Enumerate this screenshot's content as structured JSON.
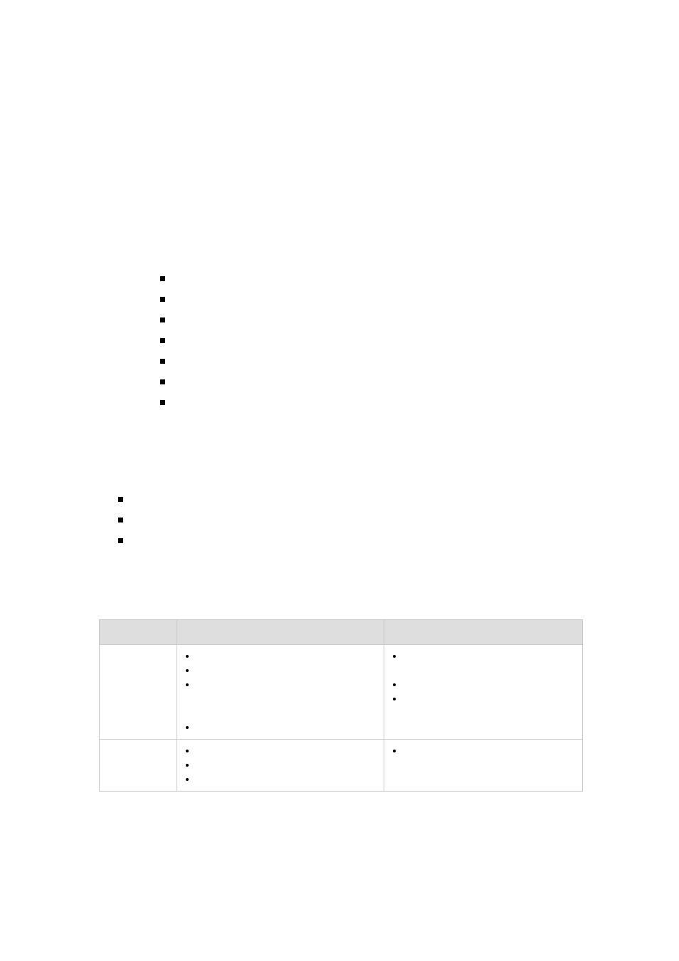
{
  "list1": {
    "count": 7
  },
  "list2": {
    "count": 3
  },
  "table": {
    "headers": [
      "",
      "",
      ""
    ],
    "rows": [
      {
        "col1": "",
        "col2_bullets": 4,
        "col2_extra_blank_after": [
          2
        ],
        "col3_bullets": 3,
        "col3_blank_slots": [
          1
        ]
      },
      {
        "col1": "",
        "col2_bullets": 3,
        "col2_extra_blank_after": [],
        "col3_bullets": 1,
        "col3_blank_slots": []
      }
    ]
  }
}
